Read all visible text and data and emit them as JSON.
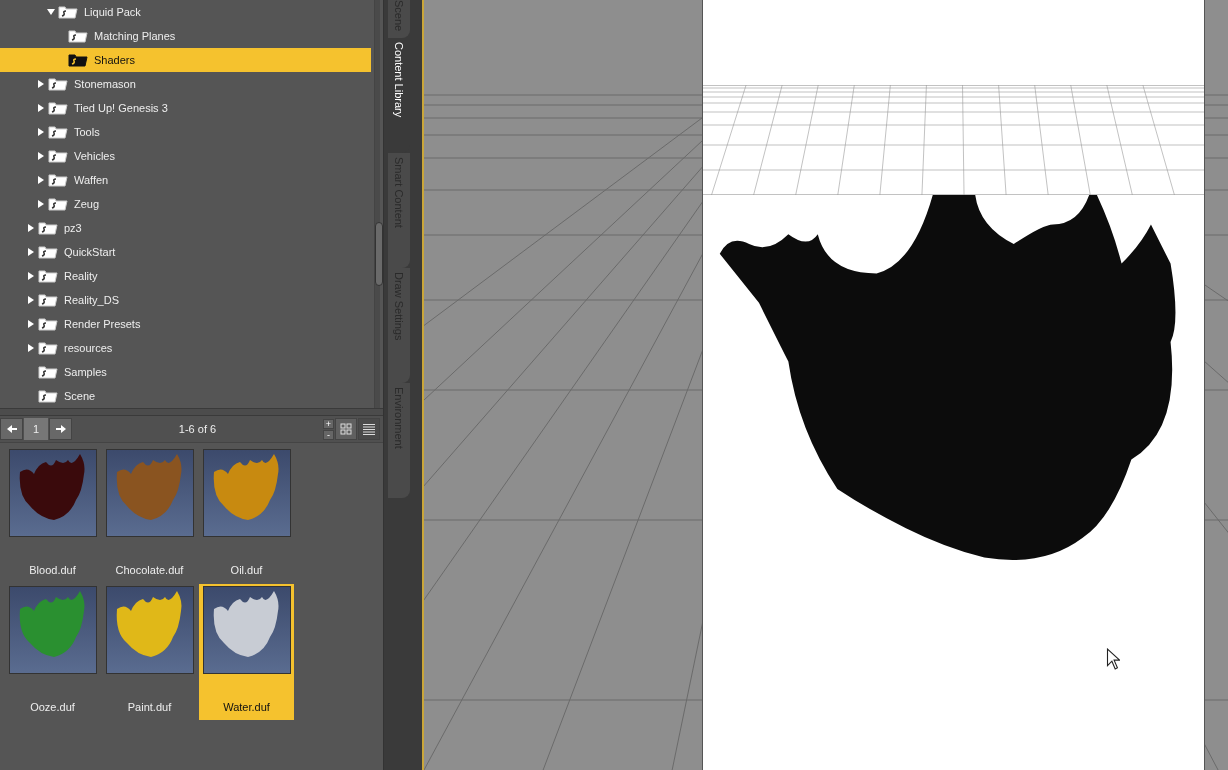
{
  "tree": [
    {
      "children": [
        {
          "children": [
            {
              "label": "Liquid Pack",
              "expandable": true,
              "expanded": true,
              "selected": false,
              "children": [
                {
                  "label": "Matching Planes",
                  "expandable": false,
                  "selected": false
                },
                {
                  "label": "Shaders",
                  "expandable": false,
                  "selected": true
                }
              ]
            }
          ]
        },
        {
          "label": "Stonemason",
          "expandable": true,
          "expanded": false,
          "selected": false
        },
        {
          "label": "Tied Up! Genesis 3",
          "expandable": true,
          "expanded": false,
          "selected": false
        },
        {
          "label": "Tools",
          "expandable": true,
          "expanded": false,
          "selected": false
        },
        {
          "label": "Vehicles",
          "expandable": true,
          "expanded": false,
          "selected": false
        },
        {
          "label": "Waffen",
          "expandable": true,
          "expanded": false,
          "selected": false
        },
        {
          "label": "Zeug",
          "expandable": true,
          "expanded": false,
          "selected": false
        }
      ]
    },
    {
      "label": "pz3",
      "expandable": true,
      "expanded": false,
      "selected": false
    },
    {
      "label": "QuickStart",
      "expandable": true,
      "expanded": false,
      "selected": false
    },
    {
      "label": "Reality",
      "expandable": true,
      "expanded": false,
      "selected": false
    },
    {
      "label": "Reality_DS",
      "expandable": true,
      "expanded": false,
      "selected": false
    },
    {
      "label": "Render Presets",
      "expandable": true,
      "expanded": false,
      "selected": false
    },
    {
      "label": "resources",
      "expandable": true,
      "expanded": false,
      "selected": false
    },
    {
      "label": "Samples",
      "expandable": false,
      "selected": false
    },
    {
      "label": "Scene",
      "expandable": false,
      "selected": false
    }
  ],
  "pager": {
    "page": "1",
    "range": "1-6 of 6",
    "zoom_in": "+",
    "zoom_out": "-",
    "views": [
      {
        "kind": "grid",
        "selected": true
      },
      {
        "kind": "list",
        "selected": false
      }
    ]
  },
  "items": [
    {
      "name": "Blood.duf",
      "color": "#3a0a0c",
      "selected": false
    },
    {
      "name": "Chocolate.duf",
      "color": "#8a5420",
      "selected": false
    },
    {
      "name": "Oil.duf",
      "color": "#c88a10",
      "selected": false
    },
    {
      "name": "Ooze.duf",
      "color": "#2a9030",
      "selected": false
    },
    {
      "name": "Paint.duf",
      "color": "#e0b818",
      "selected": false
    },
    {
      "name": "Water.duf",
      "color": "#c8ccd4",
      "selected": true
    }
  ],
  "side_tabs": [
    {
      "label": "Scene",
      "selected": false
    },
    {
      "label": "Content Library",
      "selected": true
    },
    {
      "label": "Smart Content",
      "selected": false
    },
    {
      "label": "Draw Settings",
      "selected": false
    },
    {
      "label": "Environment",
      "selected": false
    }
  ]
}
